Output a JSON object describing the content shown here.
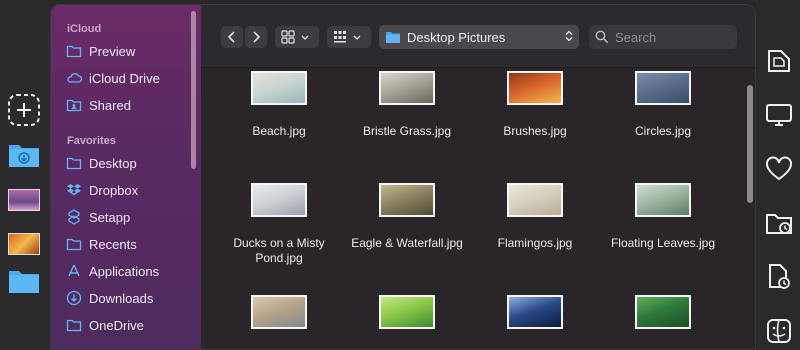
{
  "sidebar": {
    "sections": [
      {
        "title": "iCloud",
        "items": [
          {
            "label": "Preview",
            "icon": "folder-icon"
          },
          {
            "label": "iCloud Drive",
            "icon": "cloud-icon"
          },
          {
            "label": "Shared",
            "icon": "shared-folder-icon"
          }
        ]
      },
      {
        "title": "Favorites",
        "items": [
          {
            "label": "Desktop",
            "icon": "folder-icon"
          },
          {
            "label": "Dropbox",
            "icon": "dropbox-icon"
          },
          {
            "label": "Setapp",
            "icon": "setapp-icon"
          },
          {
            "label": "Recents",
            "icon": "folder-icon"
          },
          {
            "label": "Applications",
            "icon": "applications-icon"
          },
          {
            "label": "Downloads",
            "icon": "download-icon"
          },
          {
            "label": "OneDrive",
            "icon": "folder-icon"
          }
        ]
      }
    ]
  },
  "toolbar": {
    "path": "Desktop Pictures",
    "search_placeholder": "Search"
  },
  "files": [
    {
      "name": "Beach.jpg",
      "colors": [
        "#c9d6d3",
        "#9bb6ba",
        "#e7e2d6"
      ]
    },
    {
      "name": "Bristle Grass.jpg",
      "colors": [
        "#a9a59a",
        "#6b6658",
        "#d9d5c8"
      ]
    },
    {
      "name": "Brushes.jpg",
      "colors": [
        "#d8632c",
        "#f2b94b",
        "#8a3b1a"
      ]
    },
    {
      "name": "Circles.jpg",
      "colors": [
        "#5a6f8c",
        "#3b4c66",
        "#7d8ea8"
      ]
    },
    {
      "name": "Ducks on a Misty Pond.jpg",
      "colors": [
        "#cfd3d8",
        "#9aa0a8",
        "#e8eaec"
      ]
    },
    {
      "name": "Eagle & Waterfall.jpg",
      "colors": [
        "#8c8464",
        "#4e4a35",
        "#c2b98f"
      ]
    },
    {
      "name": "Flamingos.jpg",
      "colors": [
        "#d7d0c0",
        "#b8ad96",
        "#ece6d9"
      ]
    },
    {
      "name": "Floating Leaves.jpg",
      "colors": [
        "#9fb7a4",
        "#5c7d64",
        "#cfdcd1"
      ]
    },
    {
      "name": "",
      "colors": [
        "#b9a48a",
        "#7d8a8c",
        "#d9cbb6"
      ]
    },
    {
      "name": "",
      "colors": [
        "#8cc84a",
        "#3d8a2c",
        "#c9e58a"
      ]
    },
    {
      "name": "",
      "colors": [
        "#2b4a8a",
        "#0d1b3a",
        "#8fb0e0"
      ]
    },
    {
      "name": "",
      "colors": [
        "#2f7a3a",
        "#1d4d24",
        "#5fb060"
      ]
    }
  ],
  "colors": {
    "sidebar_accent": "#6a2b67",
    "folder_blue": "#3ea0f0"
  }
}
